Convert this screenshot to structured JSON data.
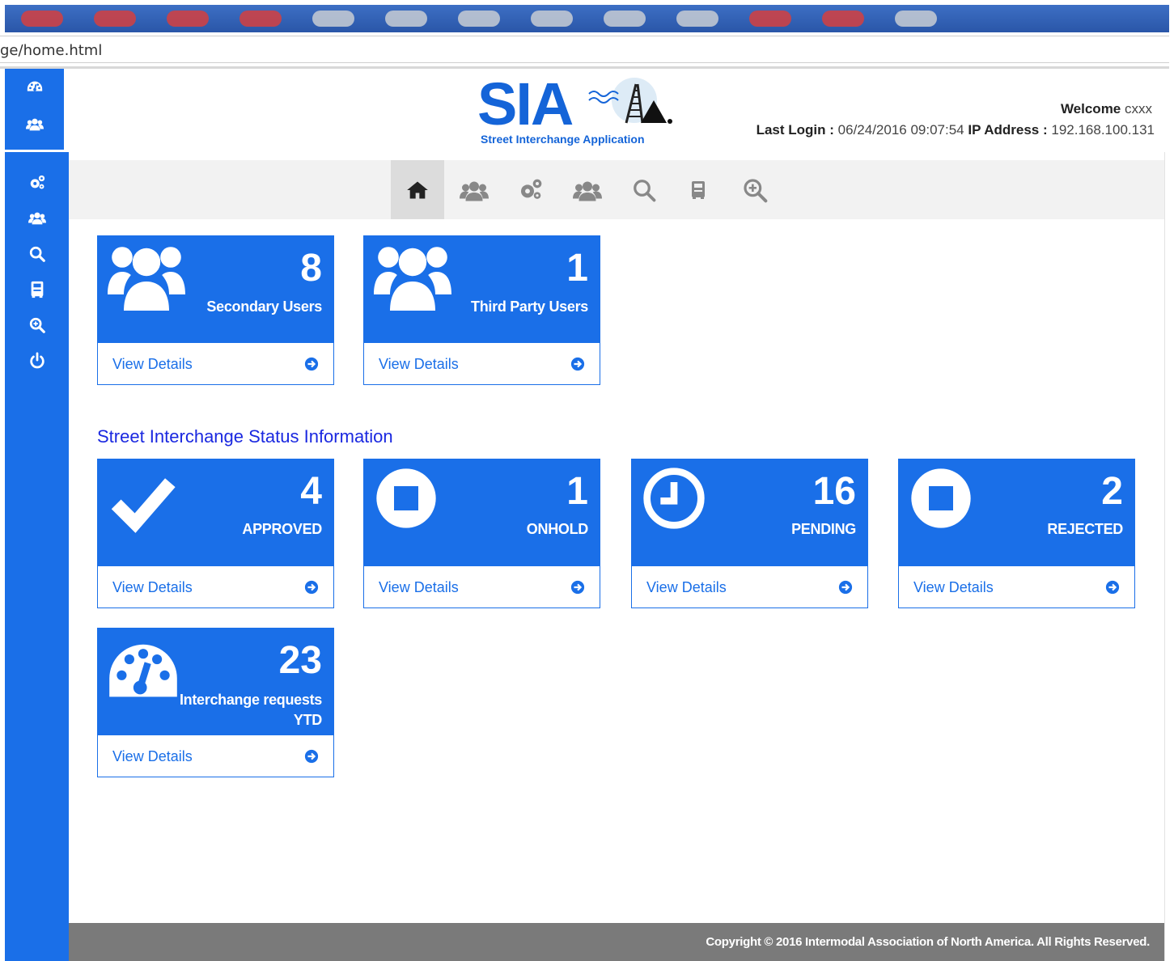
{
  "browser": {
    "address": "ge/home.html"
  },
  "header": {
    "logo_text": "SIA",
    "logo_subtitle": "Street Interchange Application",
    "welcome_label": "Welcome",
    "welcome_name": "cxxx",
    "last_login_label": "Last Login :",
    "last_login_value": "06/24/2016 09:07:54",
    "ip_label": "IP Address :",
    "ip_value": "192.168.100.131"
  },
  "sidebar": {
    "items": [
      {
        "icon": "dashboard-icon"
      },
      {
        "icon": "users-icon"
      },
      {
        "icon": "gears-icon"
      },
      {
        "icon": "group-icon"
      },
      {
        "icon": "search-icon"
      },
      {
        "icon": "truck-icon"
      },
      {
        "icon": "zoom-in-icon"
      },
      {
        "icon": "power-icon"
      }
    ]
  },
  "topnav": {
    "items": [
      {
        "icon": "home-icon",
        "active": true
      },
      {
        "icon": "users-icon"
      },
      {
        "icon": "gears-icon"
      },
      {
        "icon": "group-icon"
      },
      {
        "icon": "search-icon"
      },
      {
        "icon": "truck-icon"
      },
      {
        "icon": "zoom-in-icon"
      }
    ]
  },
  "user_tiles": [
    {
      "count": "8",
      "label": "Secondary Users",
      "link": "View Details",
      "icon": "users-icon"
    },
    {
      "count": "1",
      "label": "Third Party Users",
      "link": "View Details",
      "icon": "users-icon"
    }
  ],
  "section_title": "Street Interchange Status Information",
  "status_tiles": [
    {
      "count": "4",
      "label": "APPROVED",
      "link": "View Details",
      "icon": "check-icon"
    },
    {
      "count": "1",
      "label": "ONHOLD",
      "link": "View Details",
      "icon": "stop-circle-icon"
    },
    {
      "count": "16",
      "label": "PENDING",
      "link": "View Details",
      "icon": "clock-icon"
    },
    {
      "count": "2",
      "label": "REJECTED",
      "link": "View Details",
      "icon": "stop-circle-icon"
    }
  ],
  "ytd_tile": {
    "count": "23",
    "label_line1": "Interchange requests",
    "label_line2": "YTD",
    "link": "View Details",
    "icon": "dashboard-icon"
  },
  "footer": {
    "copyright": "Copyright © 2016 Intermodal Association of North America. All Rights Reserved."
  },
  "colors": {
    "primary": "#1a6fe8",
    "section_title": "#1a28e0",
    "footer": "#7a7a7a",
    "nav_bg": "#f2f2f2"
  }
}
